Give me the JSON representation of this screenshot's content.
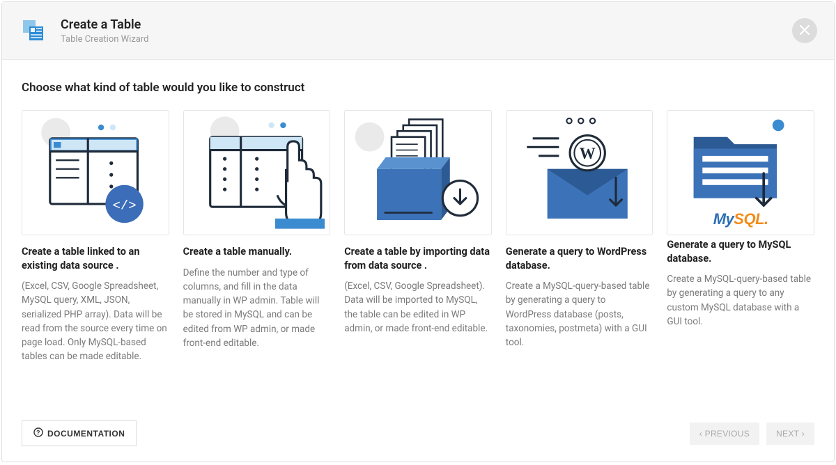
{
  "header": {
    "title": "Create a Table",
    "subtitle": "Table Creation Wizard"
  },
  "prompt": "Choose what kind of table would you like to construct",
  "options": [
    {
      "title": "Create a table linked to an existing data source .",
      "desc": "(Excel, CSV, Google Spreadsheet, MySQL query, XML, JSON, serialized PHP array). Data will be read from the source every time on page load. Only MySQL-based tables can be made editable."
    },
    {
      "title": "Create a table manually.",
      "desc": "Define the number and type of columns, and fill in the data manually in WP admin. Table will be stored in MySQL and can be edited from WP admin, or made front-end editable."
    },
    {
      "title": "Create a table by importing data from data source .",
      "desc": "(Excel, CSV, Google Spreadsheet). Data will be imported to MySQL, the table can be edited in WP admin, or made front-end editable."
    },
    {
      "title": "Generate a query to WordPress database.",
      "desc": "Create a MySQL-query-based table by generating a query to WordPress database (posts, taxonomies, postmeta) with a GUI tool."
    },
    {
      "title": "Generate a query to MySQL database.",
      "desc": "Create a MySQL-query-based table by generating a query to any custom MySQL database with a GUI tool."
    }
  ],
  "footer": {
    "documentation": "DOCUMENTATION",
    "previous": "PREVIOUS",
    "next": "NEXT"
  },
  "mysql_logo": {
    "my": "My",
    "sql": "SQL."
  }
}
